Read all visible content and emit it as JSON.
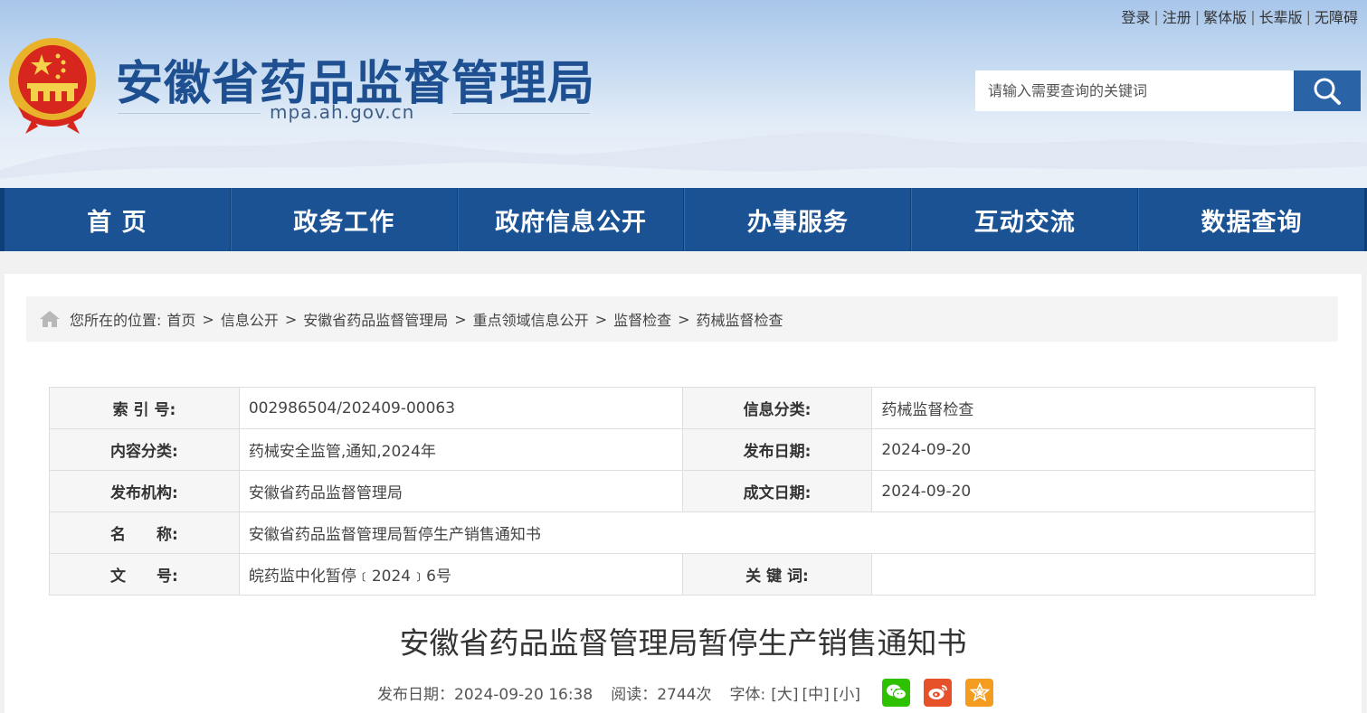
{
  "site": {
    "title": "安徽省药品监督管理局",
    "domain": "mpa.ah.gov.cn"
  },
  "toplinks": [
    "登录",
    "注册",
    "繁体版",
    "长辈版",
    "无障碍"
  ],
  "search": {
    "placeholder": "请输入需要查询的关键词"
  },
  "nav": [
    "首 页",
    "政务工作",
    "政府信息公开",
    "办事服务",
    "互动交流",
    "数据查询"
  ],
  "breadcrumb": {
    "prefix": "您所在的位置:",
    "items": [
      "首页",
      "信息公开",
      "安徽省药品监督管理局",
      "重点领域信息公开",
      "监督检查",
      "药械监督检查"
    ]
  },
  "meta": {
    "index_label": "索 引 号:",
    "index_value": "002986504/202409-00063",
    "category_label": "信息分类:",
    "category_value": "药械监督检查",
    "content_class_label": "内容分类:",
    "content_class_value": "药械安全监管,通知,2024年",
    "publish_date_label": "发布日期:",
    "publish_date_value": "2024-09-20",
    "org_label": "发布机构:",
    "org_value": "安徽省药品监督管理局",
    "created_date_label": "成文日期:",
    "created_date_value": "2024-09-20",
    "name_label": "名　　称:",
    "name_value": "安徽省药品监督管理局暂停生产销售通知书",
    "doc_no_label": "文　　号:",
    "doc_no_value": "皖药监中化暂停﹝2024﹞6号",
    "keywords_label": "关 键 词:",
    "keywords_value": ""
  },
  "article": {
    "title": "安徽省药品监督管理局暂停生产销售通知书",
    "publish": "发布日期：2024-09-20 16:38",
    "reads": "阅读：2744次",
    "font_label": "字体:",
    "font_large": "[大]",
    "font_medium": "[中]",
    "font_small": "[小]"
  },
  "colors": {
    "nav": "#1a5294",
    "title_blue": "#1e4f90",
    "wechat": "#2dc100",
    "weibo": "#e6512a",
    "favorite": "#f39c1f"
  }
}
